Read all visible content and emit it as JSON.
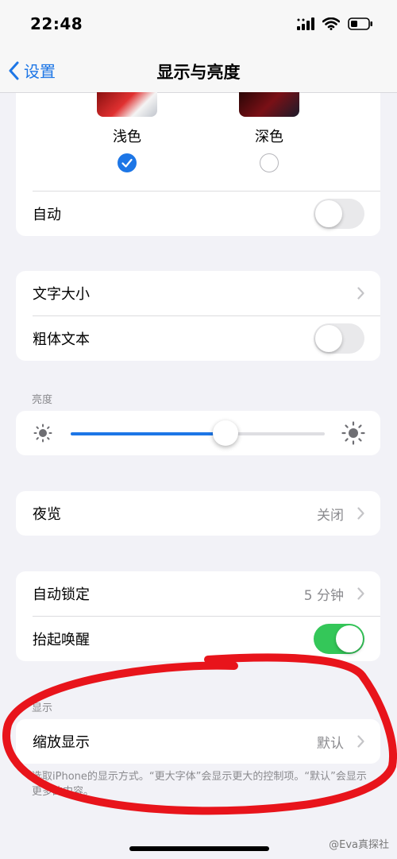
{
  "status_bar": {
    "time": "22:48"
  },
  "nav": {
    "back_label": "设置",
    "title": "显示与亮度"
  },
  "appearance": {
    "options": [
      {
        "label": "浅色",
        "selected": true
      },
      {
        "label": "深色",
        "selected": false
      }
    ],
    "auto_label": "自动",
    "auto_on": false
  },
  "text": {
    "text_size_label": "文字大小",
    "bold_text_label": "粗体文本",
    "bold_text_on": false
  },
  "brightness": {
    "header": "亮度",
    "level": 0.61
  },
  "night_shift": {
    "label": "夜览",
    "value": "关闭"
  },
  "lock": {
    "auto_lock_label": "自动锁定",
    "auto_lock_value": "5 分钟",
    "raise_to_wake_label": "抬起唤醒",
    "raise_to_wake_on": true
  },
  "display": {
    "header": "显示",
    "zoom_label": "缩放显示",
    "zoom_value": "默认",
    "footer": "选取iPhone的显示方式。“更大字体”会显示更大的控制项。“默认”会显示更多的内容。"
  },
  "watermark": "@Eva真探社",
  "colors": {
    "accent": "#1d76e6",
    "toggle_on": "#34c759",
    "annotation": "#e8141b"
  }
}
